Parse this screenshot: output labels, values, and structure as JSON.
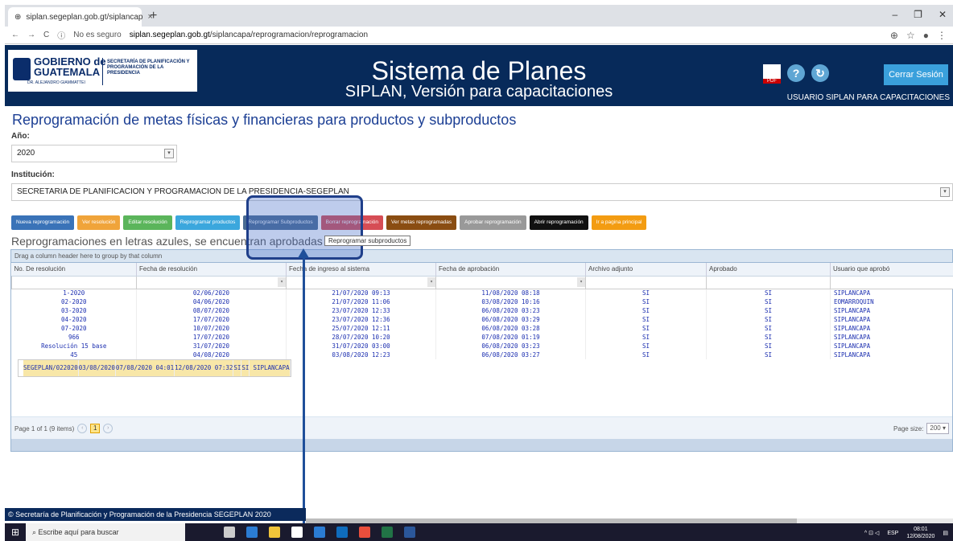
{
  "browser": {
    "tab_title": "siplan.segeplan.gob.gt/siplancap",
    "url_prefix": "No es seguro",
    "url_domain": "siplan.segeplan.gob.gt",
    "url_path": "/siplancapa/reprogramacion/reprogramacion"
  },
  "banner": {
    "logo_text1": "GOBIERNO de",
    "logo_text2": "GUATEMALA",
    "logo_sub": "DR. ALEJANDRO GIAMMATTEI",
    "logo_sec": "SECRETARÍA DE PLANIFICACIÓN Y PROGRAMACIÓN DE LA PRESIDENCIA",
    "title": "Sistema de Planes",
    "subtitle": "SIPLAN, Versión para capacitaciones",
    "logout": "Cerrar Sesión",
    "user": "USUARIO SIPLAN PARA CAPACITACIONES"
  },
  "page": {
    "heading": "Reprogramación de metas físicas y financieras para productos y subproductos",
    "year_label": "Año:",
    "year_value": "2020",
    "institution_label": "Institución:",
    "institution_value": "SECRETARIA DE PLANIFICACION Y PROGRAMACION DE LA PRESIDENCIA-SEGEPLAN",
    "note": "Reprogramaciones en letras azules, se encuentran aprobadas",
    "tooltip": "Reprogramar subproductos"
  },
  "buttons": [
    {
      "label": "Nueva reprogramación",
      "color": "#3a73b8"
    },
    {
      "label": "Ver resolución",
      "color": "#f0a43a"
    },
    {
      "label": "Editar resolución",
      "color": "#5bb55b"
    },
    {
      "label": "Reprogramar productos",
      "color": "#3ba7dd"
    },
    {
      "label": "Reprogramar Subproductos",
      "color": "#4a6c93"
    },
    {
      "label": "Borrar reprogramación",
      "color": "#d64d55"
    },
    {
      "label": "Ver metas reprogramadas",
      "color": "#8a4d12"
    },
    {
      "label": "Aprobar reprogramación",
      "color": "#999999"
    },
    {
      "label": "Abrir reprogramación",
      "color": "#111111"
    },
    {
      "label": "Ir a pagina principal",
      "color": "#f39c12"
    }
  ],
  "grid": {
    "group_hint": "Drag a column header here to group by that column",
    "columns": [
      "No. De resolución",
      "Fecha de resolución",
      "Fecha de ingreso al sistema",
      "Fecha de aprobación",
      "Archivo adjunto",
      "Aprobado",
      "Usuario que aprobó"
    ],
    "rows": [
      [
        "1-2020",
        "02/06/2020",
        "21/07/2020 09:13",
        "11/08/2020 08:18",
        "SI",
        "SI",
        "SIPLANCAPA"
      ],
      [
        "02-2020",
        "04/06/2020",
        "21/07/2020 11:06",
        "03/08/2020 10:16",
        "SI",
        "SI",
        "EOMARROQUIN"
      ],
      [
        "03-2020",
        "08/07/2020",
        "23/07/2020 12:33",
        "06/08/2020 03:23",
        "SI",
        "SI",
        "SIPLANCAPA"
      ],
      [
        "04-2020",
        "17/07/2020",
        "23/07/2020 12:36",
        "06/08/2020 03:29",
        "SI",
        "SI",
        "SIPLANCAPA"
      ],
      [
        "07-2020",
        "10/07/2020",
        "25/07/2020 12:11",
        "06/08/2020 03:28",
        "SI",
        "SI",
        "SIPLANCAPA"
      ],
      [
        "966",
        "17/07/2020",
        "28/07/2020 10:20",
        "07/08/2020 01:19",
        "SI",
        "SI",
        "SIPLANCAPA"
      ],
      [
        "Resolución 15 base",
        "31/07/2020",
        "31/07/2020 03:00",
        "06/08/2020 03:23",
        "SI",
        "SI",
        "SIPLANCAPA"
      ],
      [
        "45",
        "04/08/2020",
        "03/08/2020 12:23",
        "06/08/2020 03:27",
        "SI",
        "SI",
        "SIPLANCAPA"
      ],
      [
        "SEGEPLAN/022020",
        "03/08/2020",
        "07/08/2020 04:01",
        "12/08/2020 07:32",
        "SI",
        "SI",
        "SIPLANCAPA"
      ]
    ],
    "pager_text": "Page 1 of 1 (9 items)",
    "page_current": "1",
    "page_size_label": "Page size:",
    "page_size_value": "200"
  },
  "footer": "© Secretaría de Planificación y Programación de la Presidencia SEGEPLAN 2020",
  "taskbar": {
    "search_placeholder": "Escribe aquí para buscar",
    "lang": "ESP",
    "time": "08:01",
    "date": "12/08/2020"
  }
}
